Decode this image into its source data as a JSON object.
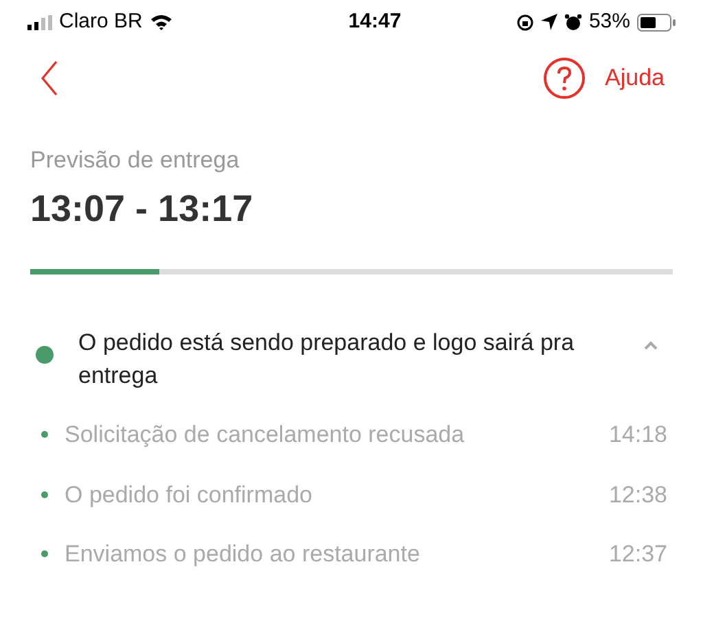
{
  "status_bar": {
    "carrier": "Claro BR",
    "time": "14:47",
    "battery": "53%"
  },
  "nav": {
    "help": "Ajuda"
  },
  "delivery": {
    "label": "Previsão de entrega",
    "window": "13:07 - 13:17",
    "level": 0.2
  },
  "current_status": {
    "text": "O pedido está sendo preparado e logo sairá pra entrega",
    "expanded": true
  },
  "history": [
    {
      "text": "Solicitação de cancelamento recusada",
      "time": "14:18"
    },
    {
      "text": "O pedido foi confirmado",
      "time": "12:38"
    },
    {
      "text": "Enviamos o pedido ao restaurante",
      "time": "12:37"
    }
  ]
}
